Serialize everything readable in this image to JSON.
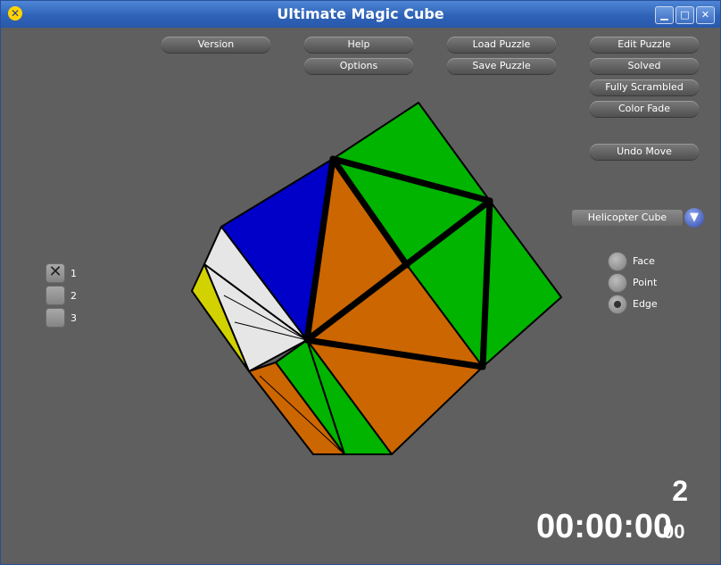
{
  "window": {
    "title": "Ultimate Magic Cube"
  },
  "toolbar": {
    "version": "Version",
    "help": "Help",
    "options": "Options",
    "load_puzzle": "Load Puzzle",
    "save_puzzle": "Save Puzzle",
    "edit_puzzle": "Edit Puzzle",
    "solved": "Solved",
    "fully_scrambled": "Fully Scrambled",
    "color_fade": "Color Fade",
    "undo_move": "Undo Move"
  },
  "puzzle_select": {
    "value": "Helicopter Cube"
  },
  "turn_mode": {
    "options": [
      "Face",
      "Point",
      "Edge"
    ],
    "selected": "Edge"
  },
  "layers": {
    "items": [
      "1",
      "2",
      "3"
    ],
    "checked": "1"
  },
  "status": {
    "move_count": "2",
    "timer": "00:00:00",
    "timer_hundredths": "00"
  },
  "colors": {
    "background": "#5f5f5f",
    "green": "#00b400",
    "orange": "#cc6600",
    "blue": "#0000c8",
    "white": "#e6e6e6",
    "yellow": "#d2d200"
  }
}
